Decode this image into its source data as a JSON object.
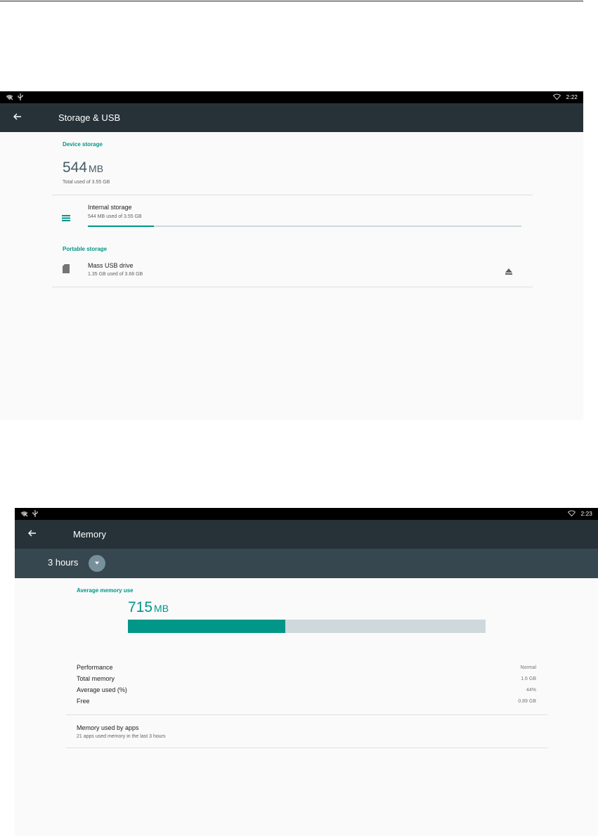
{
  "storage_screen": {
    "status_time": "2:22",
    "title": "Storage & USB",
    "device_storage_header": "Device storage",
    "used_value": "544",
    "used_unit": "MB",
    "used_summary": "Total used of 3.55 GB",
    "internal": {
      "label": "Internal storage",
      "detail": "544 MB used of 3.55 GB",
      "used_fraction": 0.153
    },
    "portable_storage_header": "Portable storage",
    "usb": {
      "label": "Mass USB drive",
      "detail": "1.35 GB used of 3.68 GB"
    }
  },
  "memory_screen": {
    "status_time": "2:23",
    "title": "Memory",
    "period": "3 hours",
    "average_header": "Average memory use",
    "average_value": "715",
    "average_unit": "MB",
    "average_used_fraction": 0.44,
    "stats": [
      {
        "label": "Performance",
        "value": "Normal"
      },
      {
        "label": "Total memory",
        "value": "1.6 GB"
      },
      {
        "label": "Average used (%)",
        "value": "44%"
      },
      {
        "label": "Free",
        "value": "0.89 GB"
      }
    ],
    "apps": {
      "label": "Memory used by apps",
      "detail": "21 apps used memory in the last 3 hours"
    }
  },
  "colors": {
    "accent": "#009688",
    "appbar": "#263238",
    "subbar": "#37474f",
    "track": "#cfd8dc"
  },
  "icons": [
    "wifi-off-icon",
    "usb-icon",
    "wifi-icon",
    "back-arrow-icon",
    "storage-list-icon",
    "sd-card-icon",
    "eject-icon",
    "dropdown-arrow-icon"
  ]
}
